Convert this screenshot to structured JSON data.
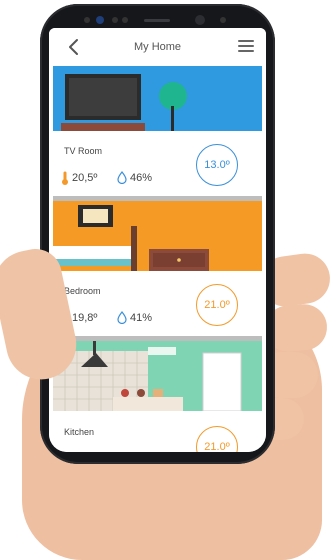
{
  "app": {
    "title": "My Home"
  },
  "colors": {
    "cool": "#3b8fd9",
    "warm": "#f39a2b",
    "drop": "#3b8fd9"
  },
  "rooms": [
    {
      "name": "TV Room",
      "temperature": "20,5º",
      "humidity": "46%",
      "setpoint": "13.0º"
    },
    {
      "name": "Bedroom",
      "temperature": "19,8º",
      "humidity": "41%",
      "setpoint": "21.0º"
    },
    {
      "name": "Kitchen",
      "setpoint": "21.0º"
    }
  ]
}
